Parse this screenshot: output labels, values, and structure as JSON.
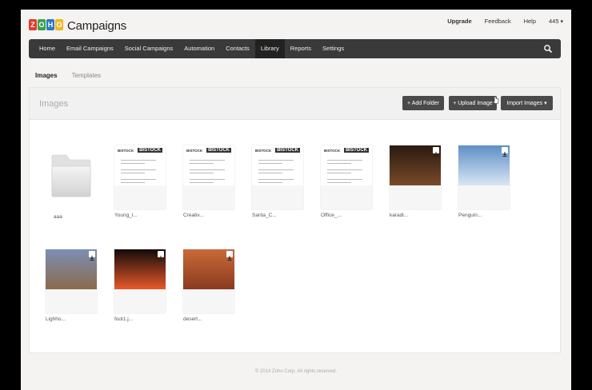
{
  "app": {
    "logo_letters": [
      "Z",
      "O",
      "H",
      "O"
    ],
    "logo_text": "Campaigns"
  },
  "toplinks": {
    "upgrade": "Upgrade",
    "feedback": "Feedback",
    "help": "Help",
    "user": "445"
  },
  "nav": {
    "items": [
      "Home",
      "Email Campaigns",
      "Social Campaigns",
      "Automation",
      "Contacts",
      "Library",
      "Reports",
      "Settings"
    ],
    "active": "Library",
    "search_icon": "search-icon"
  },
  "tabs": {
    "images": "Images",
    "templates": "Templates"
  },
  "panel": {
    "title": "Images",
    "add_folder": "+ Add Folder",
    "upload_image": "+ Upload Image",
    "import_images": "Import Images"
  },
  "items": [
    {
      "label": "aaa",
      "kind": "folder"
    },
    {
      "label": "Young_l...",
      "kind": "template"
    },
    {
      "label": "Creativ...",
      "kind": "template"
    },
    {
      "label": "Santa_C...",
      "kind": "template"
    },
    {
      "label": "Office_...",
      "kind": "template"
    },
    {
      "label": "karadi...",
      "kind": "photo",
      "colors": [
        "#2a1a10",
        "#7a4a2a"
      ]
    },
    {
      "label": "Penguin...",
      "kind": "photo",
      "colors": [
        "#5e8fc6",
        "#d9e6f3"
      ]
    },
    {
      "label": "Lighho...",
      "kind": "photo",
      "colors": [
        "#7c8fb5",
        "#8a6a4a"
      ]
    },
    {
      "label": "foot1.j...",
      "kind": "photo",
      "colors": [
        "#120a08",
        "#e8592a"
      ]
    },
    {
      "label": "desert...",
      "kind": "photo",
      "colors": [
        "#c96a3a",
        "#8a3a1e"
      ]
    }
  ],
  "template_text": {
    "brand": "BISTOCK",
    "brand_big": "BISTOCK"
  },
  "footer": "© 2014 Zoho Corp. All rights reserved."
}
